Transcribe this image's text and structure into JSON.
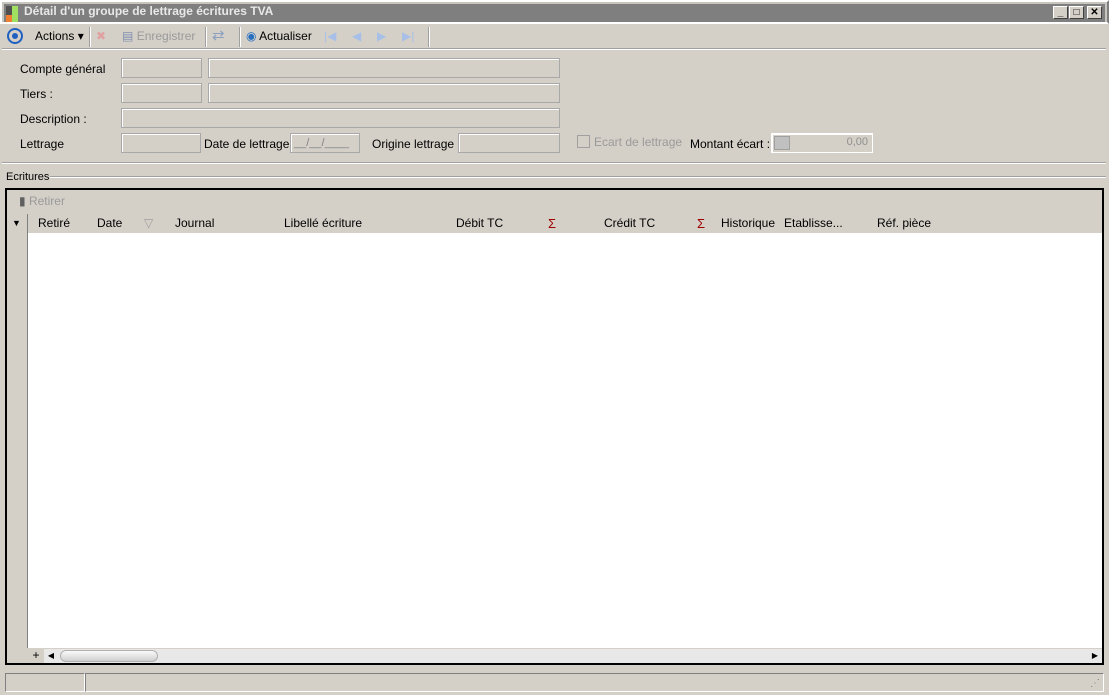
{
  "window": {
    "title": "Détail d'un groupe de lettrage écritures TVA",
    "minimize": "_",
    "maximize": "□",
    "close": "✕"
  },
  "toolbar": {
    "actions": "Actions",
    "save": "Enregistrer",
    "refresh": "Actualiser"
  },
  "form": {
    "compte_general": "Compte général",
    "tiers": "Tiers :",
    "description": "Description :",
    "lettrage": "Lettrage",
    "date_lettrage": "Date de lettrage :",
    "date_value": "__/__/____",
    "origine": "Origine lettrage :",
    "ecart": "Ecart de lettrage",
    "montant_ecart": "Montant écart :",
    "montant_value": "0,00"
  },
  "section": {
    "ecritures": "Ecritures"
  },
  "grid": {
    "remove": "Retirer",
    "columns": [
      "Retiré",
      "Date",
      "Journal",
      "Libellé écriture",
      "Débit TC",
      "Crédit TC",
      "Historique",
      "Etablisse...",
      "Réf. pièce"
    ],
    "sigma": "Σ",
    "add": "+"
  }
}
